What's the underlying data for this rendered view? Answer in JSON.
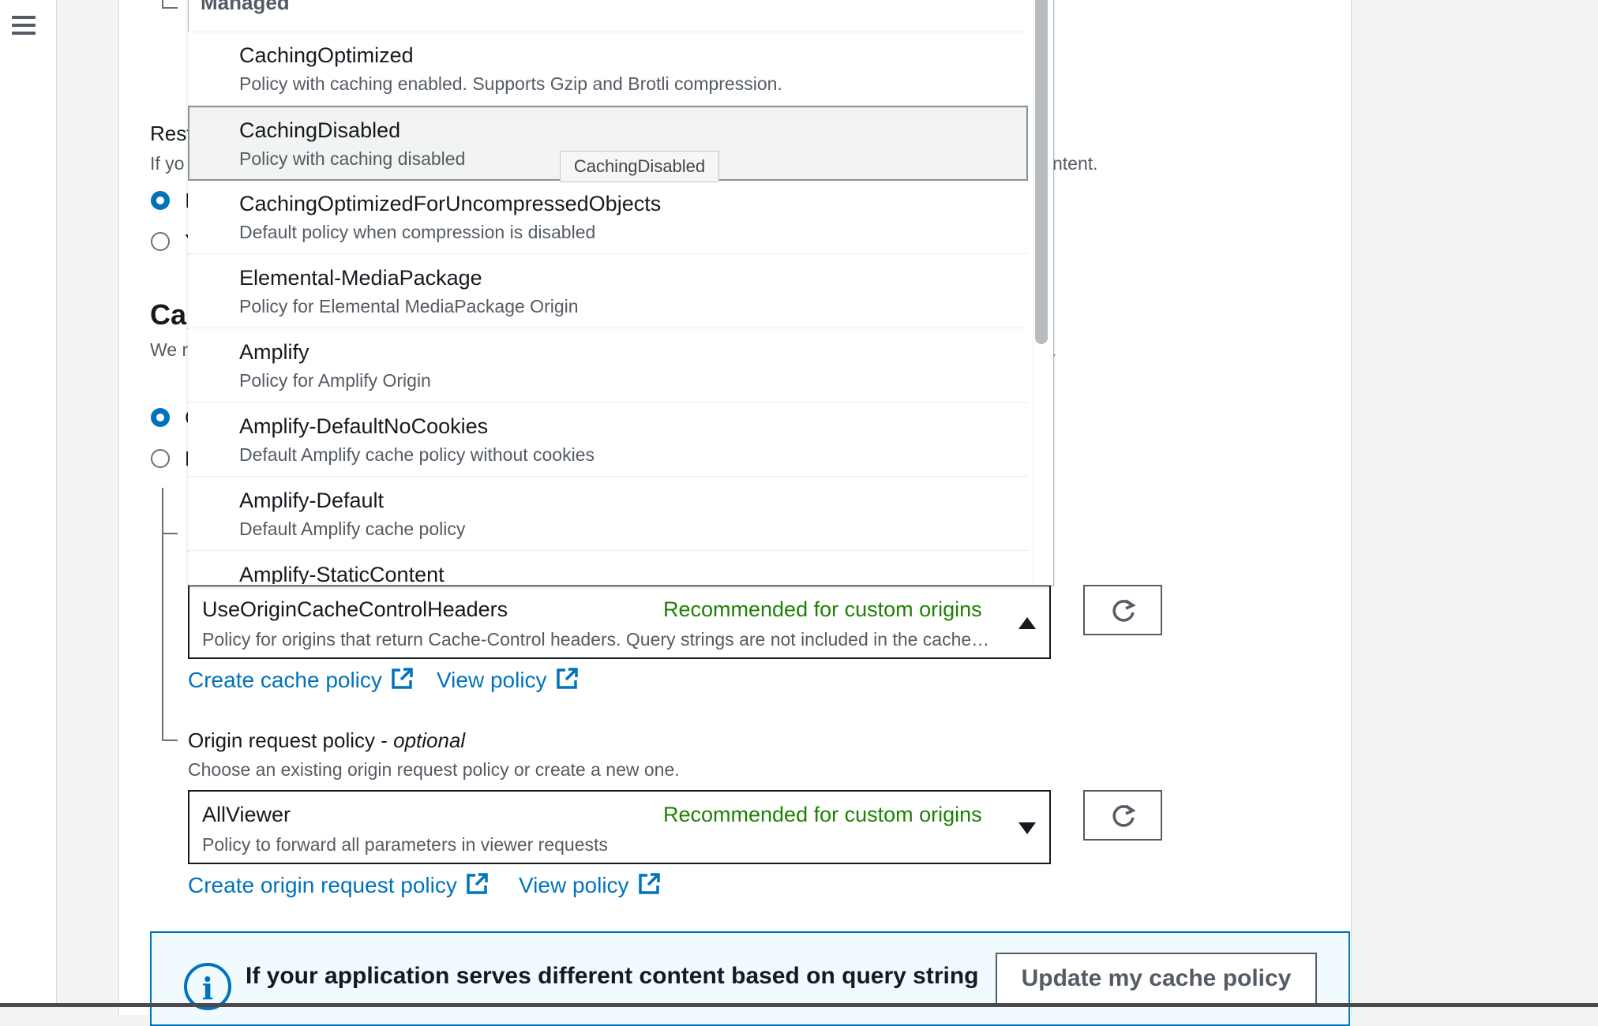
{
  "cache_policy_dropdown": {
    "group_label": "Managed",
    "highlighted_index": 1,
    "tooltip": "CachingDisabled",
    "options": [
      {
        "title": "CachingOptimized",
        "desc": "Policy with caching enabled. Supports Gzip and Brotli compression."
      },
      {
        "title": "CachingDisabled",
        "desc": "Policy with caching disabled"
      },
      {
        "title": "CachingOptimizedForUncompressedObjects",
        "desc": "Default policy when compression is disabled"
      },
      {
        "title": "Elemental-MediaPackage",
        "desc": "Policy for Elemental MediaPackage Origin"
      },
      {
        "title": "Amplify",
        "desc": "Policy for Amplify Origin"
      },
      {
        "title": "Amplify-DefaultNoCookies",
        "desc": "Default Amplify cache policy without cookies"
      },
      {
        "title": "Amplify-Default",
        "desc": "Default Amplify cache policy"
      },
      {
        "title": "Amplify-StaticContent",
        "desc": ""
      }
    ]
  },
  "background_fragments": {
    "restrict_label": "Rest",
    "restrict_hint_left": "If yo",
    "restrict_hint_right": "ntent.",
    "radio_a_text": "I",
    "radio_b_text": "Y",
    "cache_heading": "Ca",
    "cache_hint_left": "We r",
    "cache_hint_right": "s.",
    "radio_c_text": "C",
    "radio_d_text": "L"
  },
  "cache_policy": {
    "selected": "UseOriginCacheControlHeaders",
    "recommendation": "Recommended for custom origins",
    "description": "Policy for origins that return Cache-Control headers. Query strings are not included in the cache key.",
    "create_link": "Create cache policy",
    "view_link": "View policy"
  },
  "origin_request_policy": {
    "label": "Origin request policy - ",
    "label_optional": "optional",
    "hint": "Choose an existing origin request policy or create a new one.",
    "selected": "AllViewer",
    "recommendation": "Recommended for custom origins",
    "description": "Policy to forward all parameters in viewer requests",
    "create_link": "Create origin request policy",
    "view_link": "View policy"
  },
  "alert": {
    "text": "If your application serves different content based on query string",
    "button": "Update my cache policy"
  },
  "colors": {
    "link": "#0073bb",
    "recommended": "#1d8102",
    "selected_radio": "#0073bb"
  }
}
